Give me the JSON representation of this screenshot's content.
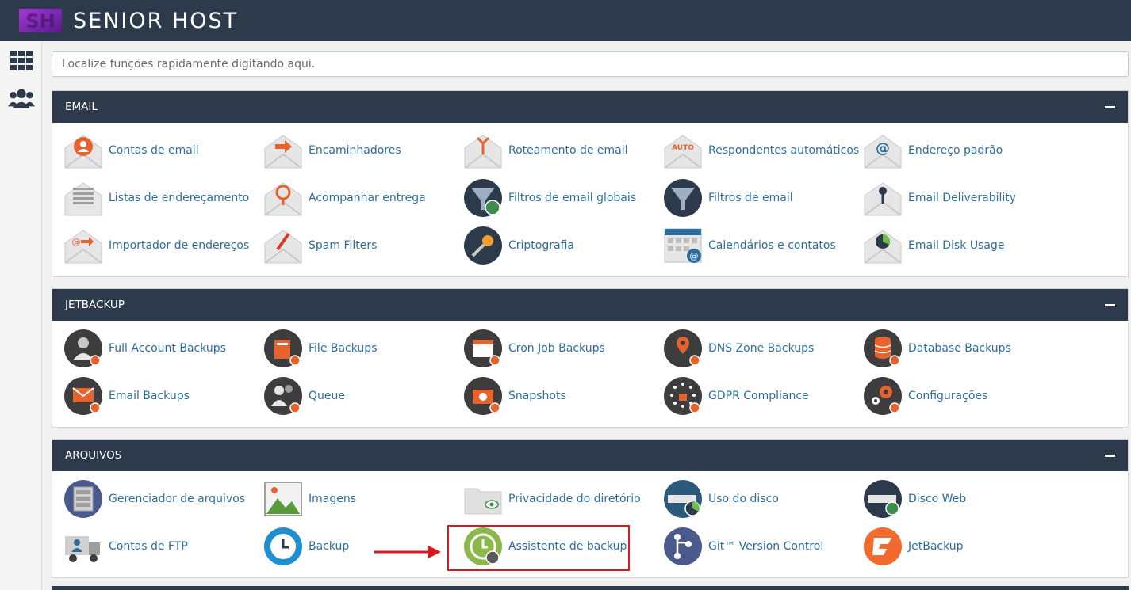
{
  "brand": {
    "name": "SENIOR HOST",
    "accent": "#7b2fb0"
  },
  "sidebar": {
    "items": [
      {
        "icon": "grid-icon"
      },
      {
        "icon": "users-icon"
      }
    ]
  },
  "search": {
    "placeholder": "Localize funções rapidamente digitando aqui."
  },
  "sections": [
    {
      "title": "EMAIL",
      "items": [
        {
          "label": "Contas de email",
          "icon": "email-accounts-icon"
        },
        {
          "label": "Encaminhadores",
          "icon": "forwarders-icon"
        },
        {
          "label": "Roteamento de email",
          "icon": "email-routing-icon"
        },
        {
          "label": "Respondentes automáticos",
          "icon": "autoresponder-icon",
          "badge": "AUTO"
        },
        {
          "label": "Endereço padrão",
          "icon": "default-address-icon"
        },
        {
          "label": "Listas de endereçamento",
          "icon": "mailing-lists-icon"
        },
        {
          "label": "Acompanhar entrega",
          "icon": "track-delivery-icon"
        },
        {
          "label": "Filtros de email globais",
          "icon": "global-filters-icon"
        },
        {
          "label": "Filtros de email",
          "icon": "email-filters-icon"
        },
        {
          "label": "Email Deliverability",
          "icon": "deliverability-icon"
        },
        {
          "label": "Importador de endereços",
          "icon": "address-importer-icon"
        },
        {
          "label": "Spam Filters",
          "icon": "spam-filters-icon"
        },
        {
          "label": "Criptografia",
          "icon": "encryption-icon"
        },
        {
          "label": "Calendários e contatos",
          "icon": "calendar-icon"
        },
        {
          "label": "Email Disk Usage",
          "icon": "email-disk-usage-icon"
        }
      ]
    },
    {
      "title": "JETBACKUP",
      "items": [
        {
          "label": "Full Account Backups",
          "icon": "full-account-backups-icon"
        },
        {
          "label": "File Backups",
          "icon": "file-backups-icon"
        },
        {
          "label": "Cron Job Backups",
          "icon": "cron-job-backups-icon"
        },
        {
          "label": "DNS Zone Backups",
          "icon": "dns-zone-backups-icon"
        },
        {
          "label": "Database Backups",
          "icon": "database-backups-icon"
        },
        {
          "label": "Email Backups",
          "icon": "email-backups-icon"
        },
        {
          "label": "Queue",
          "icon": "queue-icon"
        },
        {
          "label": "Snapshots",
          "icon": "snapshots-icon"
        },
        {
          "label": "GDPR Compliance",
          "icon": "gdpr-compliance-icon"
        },
        {
          "label": "Configurações",
          "icon": "settings-icon"
        }
      ]
    },
    {
      "title": "ARQUIVOS",
      "items": [
        {
          "label": "Gerenciador de arquivos",
          "icon": "file-manager-icon"
        },
        {
          "label": "Imagens",
          "icon": "images-icon"
        },
        {
          "label": "Privacidade do diretório",
          "icon": "directory-privacy-icon"
        },
        {
          "label": "Uso do disco",
          "icon": "disk-usage-icon"
        },
        {
          "label": "Disco Web",
          "icon": "web-disk-icon"
        },
        {
          "label": "Contas de FTP",
          "icon": "ftp-accounts-icon"
        },
        {
          "label": "Backup",
          "icon": "backup-icon"
        },
        {
          "label": "Assistente de backup",
          "icon": "backup-wizard-icon",
          "highlighted": true
        },
        {
          "label": "Git™ Version Control",
          "icon": "git-icon"
        },
        {
          "label": "JetBackup",
          "icon": "jetbackup-icon"
        }
      ]
    }
  ],
  "colors": {
    "header": "#2d3a4b",
    "link": "#2c6e9b",
    "highlight": "#d8191f"
  }
}
